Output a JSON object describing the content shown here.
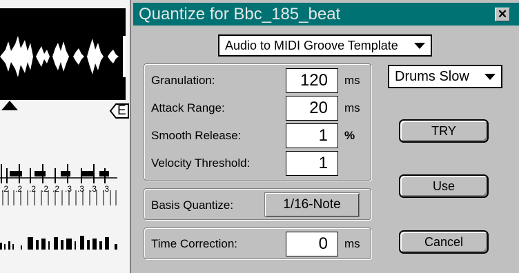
{
  "window": {
    "title": "Quantize for Bbc_185_beat",
    "close_symbol": "✕"
  },
  "mode_dropdown": {
    "value": "Audio to MIDI Groove Template"
  },
  "preset_dropdown": {
    "value": "Drums Slow"
  },
  "params": {
    "granulation": {
      "label": "Granulation:",
      "value": "120",
      "unit": "ms"
    },
    "attack_range": {
      "label": "Attack Range:",
      "value": "20",
      "unit": "ms"
    },
    "smooth_release": {
      "label": "Smooth Release:",
      "value": "1",
      "unit": "%"
    },
    "velocity_threshold": {
      "label": "Velocity Threshold:",
      "value": "1"
    }
  },
  "basis_quantize": {
    "label": "Basis Quantize:",
    "value": "1/16-Note"
  },
  "time_correction": {
    "label": "Time Correction:",
    "value": "0",
    "unit": "ms"
  },
  "buttons": {
    "try": "TRY",
    "use": "Use",
    "cancel": "Cancel"
  },
  "background": {
    "end_marker": "E",
    "ruler_numbers": [
      ".2",
      ".2",
      ".2",
      ".2",
      ".2",
      ".3",
      ".3",
      ".3",
      ".3"
    ]
  }
}
